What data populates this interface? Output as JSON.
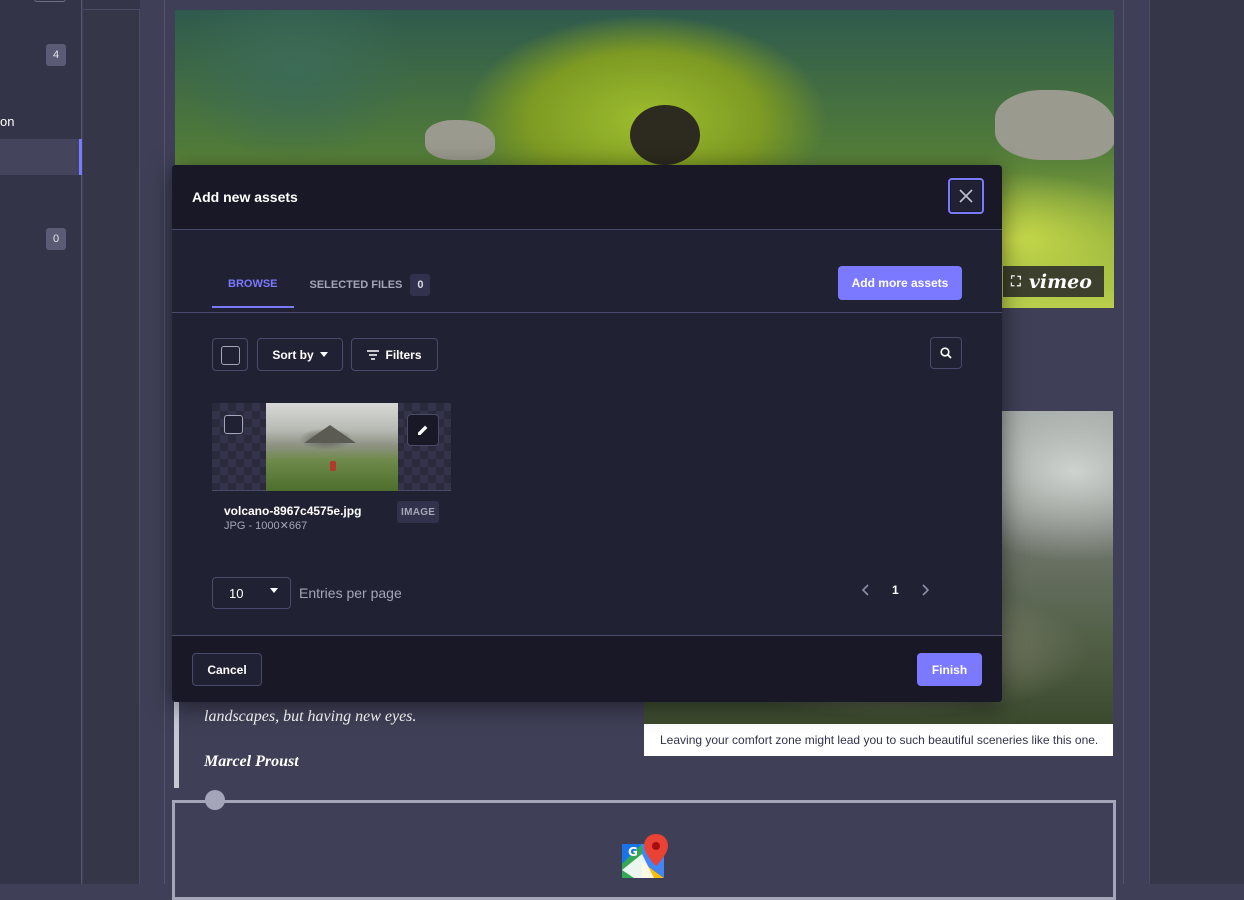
{
  "sidebar": {
    "badges": [
      "4",
      "0"
    ],
    "partial_label": "on"
  },
  "background": {
    "video_brand": "vimeo",
    "photo_caption": "Leaving your comfort zone might lead you to such beautiful sceneries like this one.",
    "quote_text": "landscapes, but having new eyes.",
    "quote_author": "Marcel Proust"
  },
  "modal": {
    "title": "Add new assets",
    "tabs": [
      {
        "label": "BROWSE",
        "active": true
      },
      {
        "label": "SELECTED FILES",
        "count": "0",
        "active": false
      }
    ],
    "add_more_label": "Add more assets",
    "sort_label": "Sort by",
    "filters_label": "Filters",
    "asset": {
      "name": "volcano-8967c4575e.jpg",
      "meta": "JPG - 1000✕667",
      "type_badge": "IMAGE"
    },
    "per_page_value": "10",
    "entries_label": "Entries per page",
    "current_page": "1",
    "cancel_label": "Cancel",
    "finish_label": "Finish"
  },
  "colors": {
    "accent": "#7b79ff",
    "modal_bg": "#212134",
    "header_bg": "#181826"
  }
}
